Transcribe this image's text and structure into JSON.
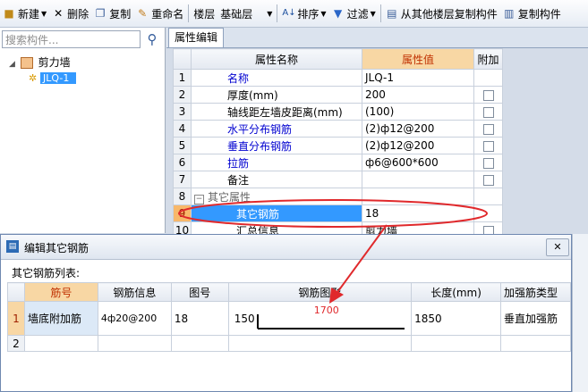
{
  "toolbar": {
    "new": "新建",
    "delete": "删除",
    "copy": "复制",
    "rename": "重命名",
    "floor": "楼层",
    "floor_value": "基础层",
    "sort": "排序",
    "filter": "过滤",
    "copy_from_floor": "从其他楼层复制构件",
    "copy_component": "复制构件"
  },
  "left_panel": {
    "search_placeholder": "搜索构件...",
    "tree_root": "剪力墙",
    "tree_child": "JLQ-1"
  },
  "editor": {
    "tab": "属性编辑",
    "col_name": "属性名称",
    "col_value": "属性值",
    "col_extra": "附加",
    "rows": [
      {
        "num": "1",
        "name": "名称",
        "value": "JLQ-1"
      },
      {
        "num": "2",
        "name": "厚度(mm)",
        "value": "200"
      },
      {
        "num": "3",
        "name": "轴线距左墙皮距离(mm)",
        "value": "(100)"
      },
      {
        "num": "4",
        "name": "水平分布钢筋",
        "value": "(2)ф12@200"
      },
      {
        "num": "5",
        "name": "垂直分布钢筋",
        "value": "(2)ф12@200"
      },
      {
        "num": "6",
        "name": "拉筋",
        "value": "ф6@600*600"
      },
      {
        "num": "7",
        "name": "备注",
        "value": ""
      },
      {
        "num": "8",
        "name": "其它属性",
        "value": ""
      },
      {
        "num": "9",
        "name": "其它钢筋",
        "value": "18"
      },
      {
        "num": "10",
        "name": "汇总信息",
        "value": "剪力墙"
      }
    ]
  },
  "dialog": {
    "title": "编辑其它钢筋",
    "list_label": "其它钢筋列表:",
    "headers": [
      "筋号",
      "钢筋信息",
      "图号",
      "钢筋图形",
      "长度(mm)",
      "加强筋类型"
    ],
    "rows": [
      {
        "num": "1",
        "bar_no": "墙底附加筋",
        "info": "4ф20@200",
        "fig": "18",
        "shape_left": "150",
        "shape_len": "1700",
        "length": "1850",
        "type": "垂直加强筋"
      },
      {
        "num": "2",
        "bar_no": "",
        "info": "",
        "fig": "",
        "shape_left": "",
        "shape_len": "",
        "length": "",
        "type": ""
      }
    ]
  },
  "colors": {
    "highlight_red": "#e0292c",
    "header_orange": "#f8d7a4",
    "selection_blue": "#3399ff"
  }
}
